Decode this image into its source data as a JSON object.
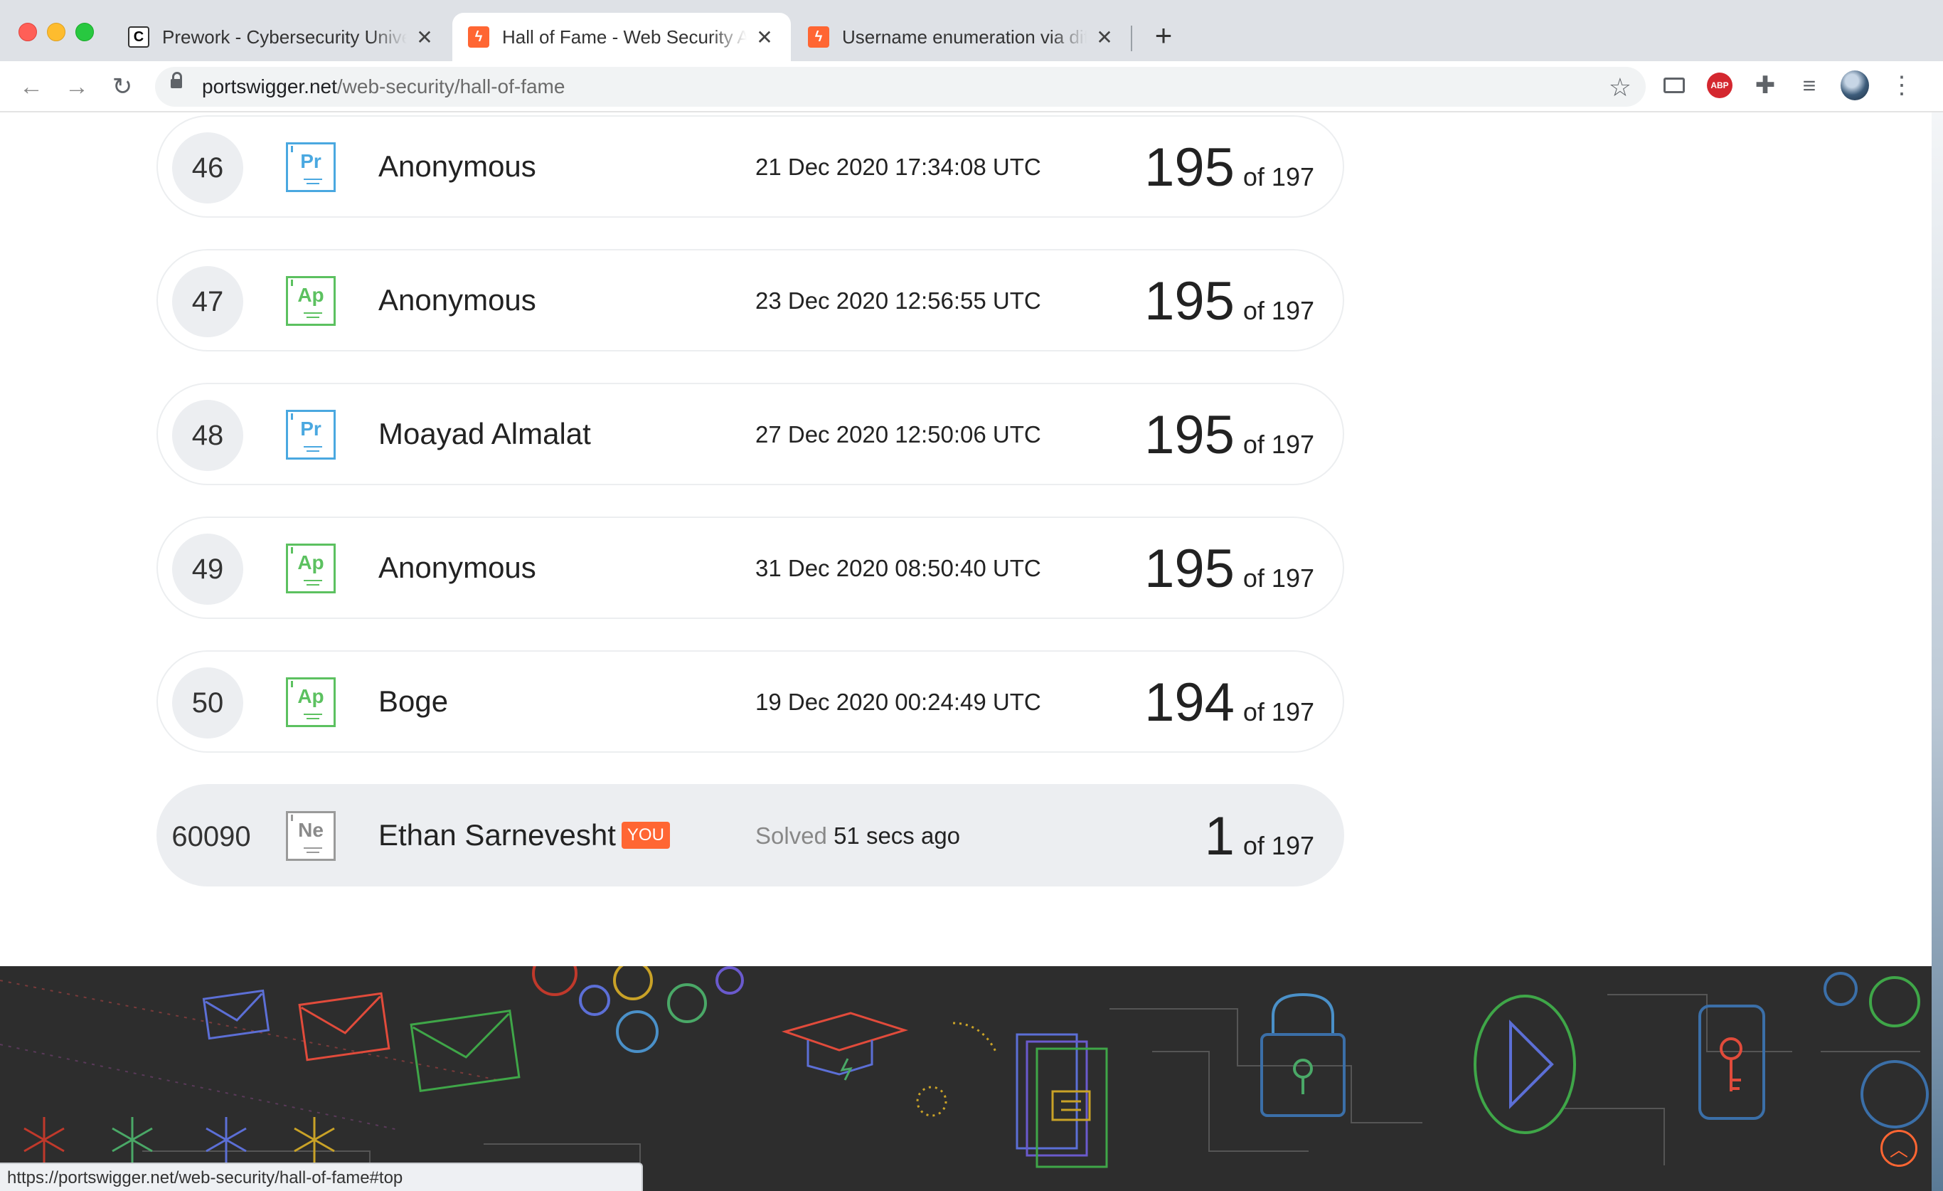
{
  "browser": {
    "tabs": [
      {
        "title": "Prework - Cybersecurity University",
        "favicon": "cyber-favicon",
        "active": false
      },
      {
        "title": "Hall of Fame - Web Security Academy",
        "favicon": "portswigger-favicon",
        "active": true
      },
      {
        "title": "Username enumeration via different responses",
        "favicon": "portswigger-favicon",
        "active": false
      }
    ],
    "close_glyph": "✕",
    "new_tab_glyph": "+",
    "url_host": "portswigger.net",
    "url_path": "/web-security/hall-of-fame",
    "abp_label": "ABP"
  },
  "leaderboard": {
    "rows": [
      {
        "rank": "46",
        "badge": "Pr",
        "badge_color": "#4aa8e0",
        "name": "Anonymous",
        "date": "21 Dec 2020 17:34:08 UTC",
        "score": "195",
        "of": "of 197"
      },
      {
        "rank": "47",
        "badge": "Ap",
        "badge_color": "#5cc160",
        "name": "Anonymous",
        "date": "23 Dec 2020 12:56:55 UTC",
        "score": "195",
        "of": "of 197"
      },
      {
        "rank": "48",
        "badge": "Pr",
        "badge_color": "#4aa8e0",
        "name": "Moayad Almalat",
        "date": "27 Dec 2020 12:50:06 UTC",
        "score": "195",
        "of": "of 197"
      },
      {
        "rank": "49",
        "badge": "Ap",
        "badge_color": "#5cc160",
        "name": "Anonymous",
        "date": "31 Dec 2020 08:50:40 UTC",
        "score": "195",
        "of": "of 197"
      },
      {
        "rank": "50",
        "badge": "Ap",
        "badge_color": "#5cc160",
        "name": "Boge",
        "date": "19 Dec 2020 00:24:49 UTC",
        "score": "194",
        "of": "of 197"
      }
    ],
    "you_row": {
      "rank": "60090",
      "badge": "Ne",
      "name": "Ethan Sarnevesht",
      "you_tag": "YOU",
      "solved_label": "Solved",
      "solved_time": "51 secs ago",
      "score": "1",
      "of": "of 197"
    }
  },
  "status_url": "https://portswigger.net/web-security/hall-of-fame#top",
  "colors": {
    "accent": "#ff6633",
    "footer_bg": "#2d2d2d"
  }
}
